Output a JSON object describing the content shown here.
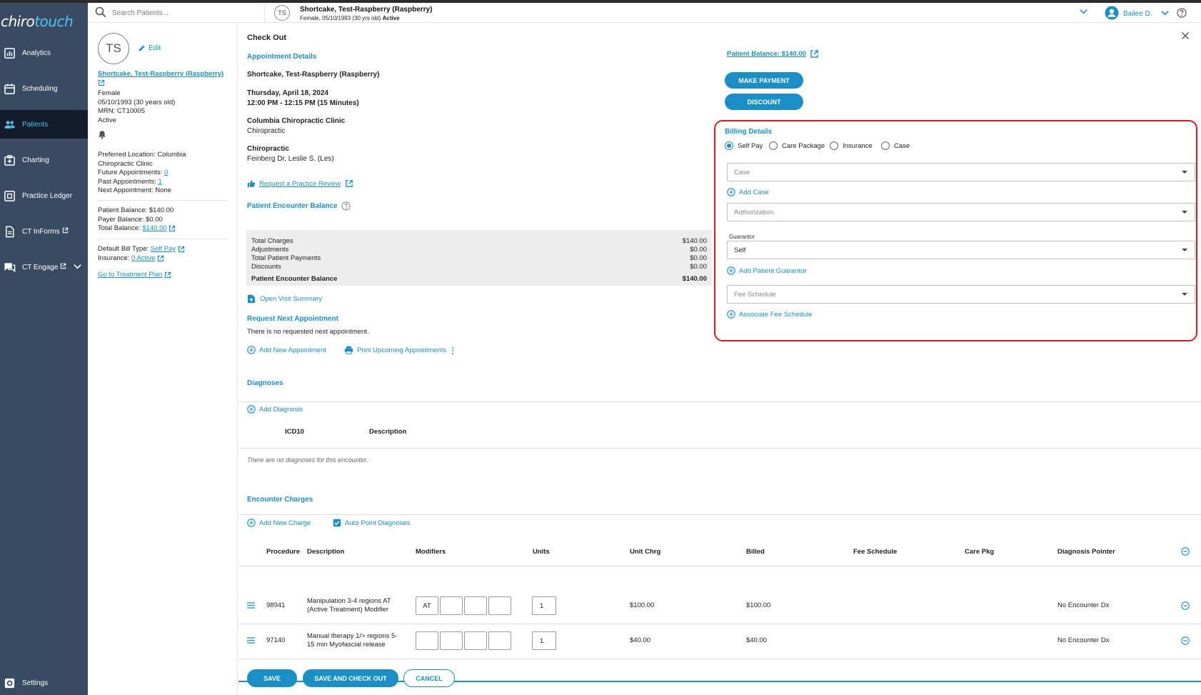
{
  "app": {
    "logo_part1": "chiro",
    "logo_part2": "touch"
  },
  "colors": {
    "sidebar_bg": "#394b63",
    "accent": "#1a8fc6",
    "highlight_border": "#e3161e",
    "nav_active_bg": "#121c2a"
  },
  "sidebar": {
    "items": [
      {
        "label": "Analytics",
        "icon": "analytics-icon"
      },
      {
        "label": "Scheduling",
        "icon": "calendar-icon"
      },
      {
        "label": "Patients",
        "icon": "users-icon",
        "active": true
      },
      {
        "label": "Charting",
        "icon": "medical-chart-icon"
      },
      {
        "label": "Practice Ledger",
        "icon": "ledger-icon"
      },
      {
        "label": "CT InForms",
        "icon": "document-icon"
      },
      {
        "label": "CT Engage",
        "icon": "chat-icon"
      }
    ],
    "settings_label": "Settings"
  },
  "header": {
    "search_placeholder": "Search Patients...",
    "avatar_initials": "TS",
    "patient_name": "Shortcake, Test-Raspberry (Raspberry)",
    "patient_sub": "Female, 05/10/1993 (30 yrs old)",
    "patient_status": "Active",
    "user_name": "Bailee D."
  },
  "patient_panel": {
    "initials": "TS",
    "edit_label": "Edit",
    "name_link": "Shortcake, Test-Raspberry (Raspberry)",
    "gender": "Female",
    "dob": "05/10/1993 (30 years old)",
    "mrn": "MRN: CT10005",
    "status": "Active",
    "preferred_location_1": "Preferred Location: Columbia",
    "preferred_location_2": "Chiropractic Clinic",
    "future_appts_label": "Future Appointments:",
    "future_appts_value": "0",
    "past_appts_label": "Past Appointments:",
    "past_appts_value": "1",
    "next_appt": "Next Appointment: None",
    "patient_balance": "Patient Balance: $140.00",
    "payer_balance": "Payer Balance: $0.00",
    "total_balance_label": "Total Balance:",
    "total_balance_value": "$140.00",
    "default_bill_label": "Default Bill Type:",
    "default_bill_value": "Self Pay",
    "insurance_label": "Insurance:",
    "insurance_value": "0 Active",
    "treatment_plan": "Go to Treatment Plan"
  },
  "checkout": {
    "title": "Check Out",
    "appointment_details_title": "Appointment Details",
    "patient_name": "Shortcake, Test-Raspberry (Raspberry)",
    "date": "Thursday, April 18, 2024",
    "time": "12:00 PM - 12:15 PM (15 Minutes)",
    "clinic_name": "Columbia Chiropractic Clinic",
    "clinic_type": "Chiropractic",
    "provider_type": "Chiropractic",
    "provider_name": "Feinberg Dr, Leslie S. (Les)",
    "review_link": "Request a Practice Review",
    "balance_title": "Patient Encounter Balance",
    "balance_rows": [
      {
        "label": "Total Charges",
        "value": "$140.00"
      },
      {
        "label": "Adjustments",
        "value": "$0.00"
      },
      {
        "label": "Total Patient Payments",
        "value": "$0.00"
      },
      {
        "label": "Discounts",
        "value": "$0.00"
      }
    ],
    "balance_total_label": "Patient Encounter Balance",
    "balance_total_value": "$140.00",
    "open_visit_summary": "Open Visit Summary",
    "request_next_title": "Request Next Appointment",
    "no_next_text": "There is no requested next appointment.",
    "add_new_appt": "Add New Appointment",
    "print_upcoming": "Print Upcoming Appointments",
    "patient_balance_link": "Patient Balance: $140.00",
    "make_payment": "MAKE PAYMENT",
    "discount": "DISCOUNT"
  },
  "billing": {
    "title": "Billing Details",
    "options": [
      "Self Pay",
      "Care Package",
      "Insurance",
      "Case"
    ],
    "selected": "Self Pay",
    "case_placeholder": "Case",
    "add_case": "Add Case",
    "authorization_placeholder": "Authorization",
    "guarantor_label": "Guarantor",
    "guarantor_value": "Self",
    "add_guarantor": "Add Patient Guarantor",
    "fee_schedule_placeholder": "Fee Schedule",
    "associate_fee": "Associate Fee Schedule"
  },
  "diagnoses": {
    "title": "Diagnoses",
    "add_label": "Add Diagnosis",
    "col_icd": "ICD10",
    "col_desc": "Description",
    "empty_text": "There are no diagnoses for this encounter."
  },
  "charges": {
    "title": "Encounter Charges",
    "add_new": "Add New Charge",
    "auto_point": "Auto Point Diagnoses",
    "columns": [
      "Procedure",
      "Description",
      "Modifiers",
      "Units",
      "Unit Chrg",
      "Billed",
      "Fee Schedule",
      "Care Pkg",
      "Diagnosis Pointer"
    ],
    "rows": [
      {
        "procedure": "98941",
        "desc_1": "Manipulation 3-4 regions AT",
        "desc_2": "(Active Treatment) Modifier",
        "modifiers": [
          "AT",
          "",
          "",
          ""
        ],
        "units": "1",
        "unit_chrg": "$100.00",
        "billed": "$100.00",
        "dx": "No Encounter Dx"
      },
      {
        "procedure": "97140",
        "desc_1": "Manual therapy 1/> regions 5-",
        "desc_2": "15 min Myofascial release",
        "modifiers": [
          "",
          "",
          "",
          ""
        ],
        "units": "1",
        "unit_chrg": "$40.00",
        "billed": "$40.00",
        "dx": "No Encounter Dx"
      }
    ]
  },
  "footer": {
    "save": "SAVE",
    "save_checkout": "SAVE AND CHECK OUT",
    "cancel": "CANCEL"
  }
}
